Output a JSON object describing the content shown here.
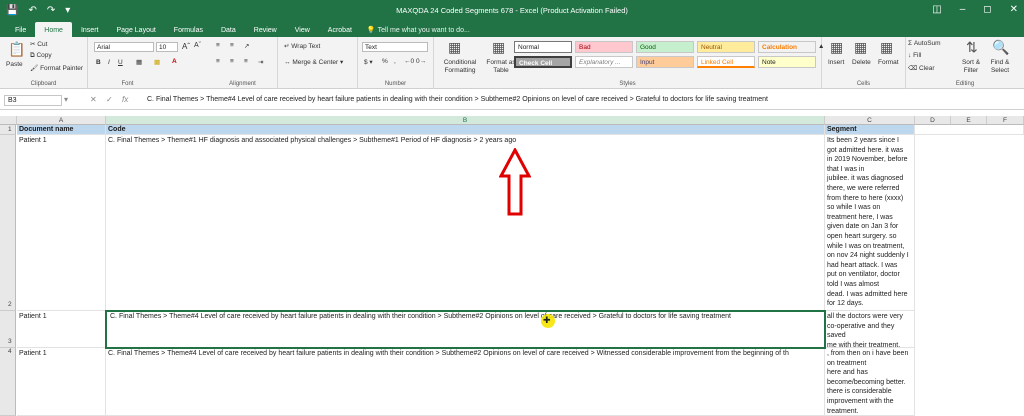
{
  "titlebar": {
    "title": "MAXQDA 24 Coded Segments 678 - Excel (Product Activation Failed)"
  },
  "tabs": [
    "File",
    "Home",
    "Insert",
    "Page Layout",
    "Formulas",
    "Data",
    "Review",
    "View",
    "Acrobat"
  ],
  "tellme": "Tell me what you want to do...",
  "ribbon": {
    "clipboard": {
      "paste": "Paste",
      "cut": "Cut",
      "copy": "Copy",
      "format_painter": "Format Painter",
      "label": "Clipboard"
    },
    "font": {
      "name": "Arial",
      "size": "10",
      "label": "Font"
    },
    "alignment": {
      "wrap": "Wrap Text",
      "merge": "Merge & Center",
      "label": "Alignment"
    },
    "number": {
      "format": "Text",
      "label": "Number"
    },
    "styles": {
      "cond": "Conditional Formatting",
      "table": "Format as Table",
      "items": [
        "Normal",
        "Bad",
        "Good",
        "Neutral",
        "Calculation",
        "Check Cell",
        "Explanatory ...",
        "Input",
        "Linked Cell",
        "Note"
      ],
      "label": "Styles"
    },
    "cells": {
      "insert": "Insert",
      "delete": "Delete",
      "format": "Format",
      "label": "Cells"
    },
    "editing": {
      "autosum": "AutoSum",
      "fill": "Fill",
      "clear": "Clear",
      "sort": "Sort & Filter",
      "find": "Find & Select",
      "label": "Editing"
    }
  },
  "formula_bar": {
    "name_box": "B3",
    "content": "C. Final Themes > Theme#4 Level of care received  by heart failure patients in  dealing with their condition > Subtheme#2 Opinions on level of care received > Grateful to doctors for life saving treatment"
  },
  "columns": [
    "A",
    "B",
    "C",
    "D",
    "E",
    "F"
  ],
  "headers": {
    "a": "Document name",
    "b": "Code",
    "c": "Segment"
  },
  "rows": [
    {
      "num": "1"
    },
    {
      "num": "2",
      "doc": "Patient 1",
      "code": "C. Final Themes > Theme#1 HF diagnosis and associated physical challenges > Subtheme#1 Period of HF diagnosis > 2 years ago",
      "segment": "Its been 2 years since I\ngot admitted here. it was\nin 2019 November, before\nthat I was in\njubilee. it was diagnosed\nthere, we were referred\nfrom there to here (xxxx)\nso while I was on\ntreatment here, I was\ngiven date on Jan 3 for\nopen heart surgery. so\nwhile I was on treatment,\non nov 24 night suddenly I\nhad heart attack. I was\nput on ventilator, doctor\ntold I was almost\ndead. I was admitted here\nfor 12 days."
    },
    {
      "num": "3",
      "doc": "Patient 1",
      "code": "C. Final Themes > Theme#4 Level of care received  by heart failure patients in  dealing with their condition > Subtheme#2 Opinions on level of care received > Grateful to doctors for life saving treatment",
      "segment": "all the doctors were very\nco-operative and they\nsaved\nme with their treatment."
    },
    {
      "num": "4",
      "doc": "Patient 1",
      "code": "C. Final Themes > Theme#4 Level of care received  by heart failure patients in  dealing with their condition > Subtheme#2 Opinions on level of care received > Witnessed considerable improvement from the beginning of th",
      "segment": ", from then on i have been\non treatment\nhere and has\nbecome/becoming better.\nthere is considerable\nimprovement with the\ntreatment."
    }
  ]
}
